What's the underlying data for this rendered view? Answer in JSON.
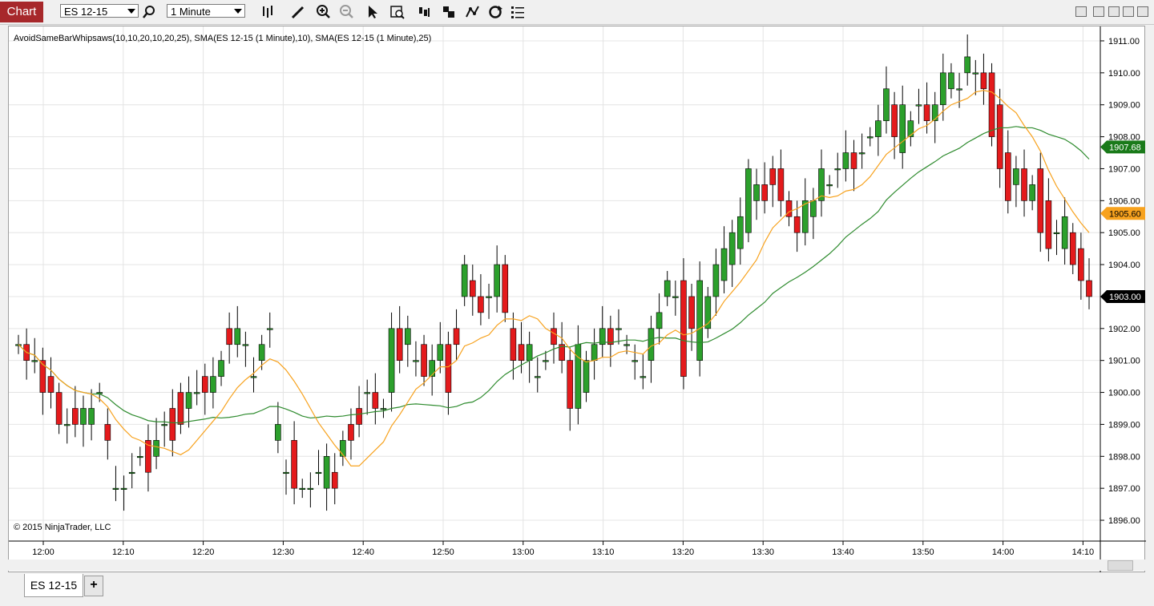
{
  "toolbar": {
    "chart_label": "Chart",
    "instrument": "ES 12-15",
    "interval": "1 Minute",
    "icons": [
      "search-icon",
      "bar-type-icon",
      "pencil-icon",
      "zoom-in-icon",
      "zoom-out-icon",
      "pointer-icon",
      "data-box-icon",
      "properties-icon",
      "strategies-icon",
      "indicators-icon",
      "reload-icon",
      "list-icon"
    ],
    "window_icons": [
      "minimize-icon",
      "tile-icon",
      "maximize-icon",
      "close-icon"
    ]
  },
  "chart": {
    "indicator_title": "AvoidSameBarWhipsaws(10,10,20,10,20,25), SMA(ES 12-15 (1 Minute),10), SMA(ES 12-15 (1 Minute),25)",
    "copyright": "© 2015 NinjaTrader, LLC",
    "price_labels": [
      "1911.00",
      "1910.00",
      "1909.00",
      "1908.00",
      "1907.00",
      "1906.00",
      "1905.00",
      "1904.00",
      "1903.00",
      "1902.00",
      "1901.00",
      "1900.00",
      "1899.00",
      "1898.00",
      "1897.00",
      "1896.00"
    ],
    "time_labels": [
      "12:00",
      "12:10",
      "12:20",
      "12:30",
      "12:40",
      "12:50",
      "13:00",
      "13:10",
      "13:20",
      "13:30",
      "13:40",
      "13:50",
      "14:00",
      "14:10"
    ],
    "markers": [
      {
        "label": "1907.68",
        "color": "#1a7a1a"
      },
      {
        "label": "1905.60",
        "color": "#f7a21e"
      },
      {
        "label": "1903.00",
        "color": "#000000"
      }
    ],
    "colors": {
      "up": "#2ca02c",
      "down": "#e41a1c",
      "sma10": "#f7a21e",
      "sma25": "#2e8b2e",
      "buy": "#0000ff",
      "sell": "#ff00ff"
    }
  },
  "chart_data": {
    "type": "candlestick",
    "ylim": [
      1895.7,
      1911.2
    ],
    "open": [
      1901.5,
      1901.5,
      1901.0,
      1901.0,
      1900.5,
      1900.0,
      1899.0,
      1899.5,
      1899.0,
      1899.0,
      1900.0,
      1899.0,
      1897.0,
      1897.0,
      1897.5,
      1898.0,
      1898.5,
      1898.0,
      1899.0,
      1899.5,
      1900.0,
      1899.5,
      1900.0,
      1900.5,
      1900.0,
      1900.5,
      1902.0,
      1901.5,
      1901.5,
      1900.5,
      1901.0,
      1902.0,
      1898.5,
      1897.5,
      1898.5,
      1897.0,
      1897.0,
      1897.5,
      1897.0,
      1897.5,
      1898.0,
      1899.0,
      1899.5,
      1900.0,
      1900.0,
      1899.5,
      1900.0,
      1902.0,
      1901.5,
      1901.0,
      1901.5,
      1900.5,
      1901.0,
      1901.5,
      1902.0,
      1903.0,
      1903.5,
      1903.0,
      1903.0,
      1903.0,
      1904.0,
      1902.0,
      1901.5,
      1901.0,
      1900.5,
      1901.0,
      1902.0,
      1901.5,
      1901.0,
      1899.5,
      1900.0,
      1901.0,
      1901.5,
      1902.0,
      1902.0,
      1901.5,
      1901.0,
      1900.5,
      1901.0,
      1902.0,
      1903.0,
      1903.0,
      1903.5,
      1903.0,
      1901.0,
      1902.0,
      1903.0,
      1903.5,
      1904.0,
      1904.5,
      1905.0,
      1906.0,
      1906.5,
      1907.0,
      1907.0,
      1906.0,
      1905.5,
      1905.0,
      1905.5,
      1906.0,
      1906.5,
      1907.0,
      1907.0,
      1907.5,
      1907.5,
      1908.0,
      1908.0,
      1908.5,
      1909.0,
      1907.5,
      1908.0,
      1909.0,
      1909.0,
      1908.5,
      1909.0,
      1909.5,
      1909.5,
      1910.0,
      1910.0,
      1910.0,
      1910.0,
      1909.0,
      1907.5,
      1906.5,
      1907.0,
      1906.0,
      1907.0,
      1906.0,
      1905.0,
      1904.5,
      1905.0,
      1904.5,
      1903.5
    ],
    "close": [
      1901.5,
      1901.0,
      1901.0,
      1900.0,
      1900.0,
      1899.0,
      1899.0,
      1899.0,
      1899.5,
      1899.5,
      1900.0,
      1898.5,
      1897.0,
      1897.0,
      1897.5,
      1898.0,
      1897.5,
      1898.5,
      1899.0,
      1898.5,
      1899.0,
      1900.0,
      1900.0,
      1900.0,
      1900.5,
      1901.0,
      1901.5,
      1902.0,
      1901.5,
      1900.5,
      1901.5,
      1902.0,
      1899.0,
      1897.5,
      1897.0,
      1897.0,
      1897.0,
      1897.5,
      1898.0,
      1897.0,
      1898.5,
      1898.5,
      1899.0,
      1900.0,
      1899.5,
      1899.5,
      1902.0,
      1901.0,
      1902.0,
      1901.0,
      1900.5,
      1901.0,
      1901.5,
      1900.0,
      1901.5,
      1904.0,
      1903.0,
      1902.5,
      1903.0,
      1904.0,
      1902.5,
      1901.0,
      1901.0,
      1901.5,
      1900.5,
      1901.0,
      1901.5,
      1901.0,
      1899.5,
      1901.5,
      1901.0,
      1901.5,
      1902.0,
      1901.5,
      1902.0,
      1901.5,
      1901.0,
      1900.5,
      1902.0,
      1902.5,
      1903.5,
      1903.0,
      1900.5,
      1902.0,
      1903.5,
      1903.0,
      1904.0,
      1904.5,
      1905.0,
      1905.5,
      1907.0,
      1906.5,
      1906.0,
      1906.5,
      1906.0,
      1905.5,
      1905.0,
      1906.0,
      1906.0,
      1907.0,
      1906.5,
      1907.0,
      1907.5,
      1907.0,
      1907.5,
      1908.0,
      1908.5,
      1909.5,
      1908.0,
      1909.0,
      1908.5,
      1909.0,
      1908.5,
      1909.0,
      1910.0,
      1910.0,
      1909.5,
      1910.5,
      1910.0,
      1909.5,
      1908.0,
      1907.0,
      1906.0,
      1907.0,
      1906.0,
      1906.5,
      1905.0,
      1904.5,
      1905.0,
      1905.5,
      1904.0,
      1903.5,
      1903.0
    ]
  }
}
